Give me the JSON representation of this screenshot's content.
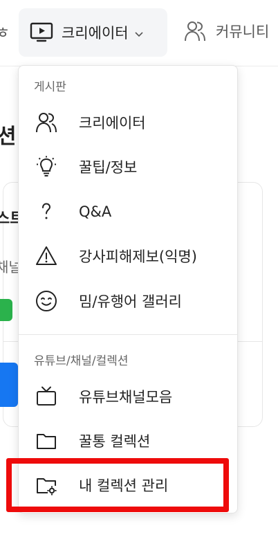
{
  "nav": {
    "left_stub": "ㅎ",
    "active_tab": {
      "label": "크리에이터",
      "icon": "tv-icon"
    },
    "second_tab": {
      "label": "커뮤니티",
      "icon": "users-icon"
    }
  },
  "background": {
    "heading": "션",
    "card_text1": "스트",
    "card_text2": "채널"
  },
  "dropdown": {
    "sections": [
      {
        "label": "게시판",
        "items": [
          {
            "label": "크리에이터",
            "icon": "users-icon"
          },
          {
            "label": "꿀팁/정보",
            "icon": "lightbulb-icon"
          },
          {
            "label": "Q&A",
            "icon": "question-icon"
          },
          {
            "label": "강사피해제보(익명)",
            "icon": "warning-icon"
          },
          {
            "label": "밈/유행어 갤러리",
            "icon": "smile-icon"
          }
        ]
      },
      {
        "label": "유튜브/채널/컬렉션",
        "items": [
          {
            "label": "유튜브채널모음",
            "icon": "tv-icon"
          },
          {
            "label": "꿀통 컬렉션",
            "icon": "folder-icon"
          },
          {
            "label": "내 컬렉션 관리",
            "icon": "folder-settings-icon"
          }
        ]
      }
    ]
  },
  "colors": {
    "highlight": "#ee0b0b",
    "active_tab_bg": "#f4f5f7",
    "green_badge": "#2bb24c",
    "blue_button": "#1677f2"
  }
}
